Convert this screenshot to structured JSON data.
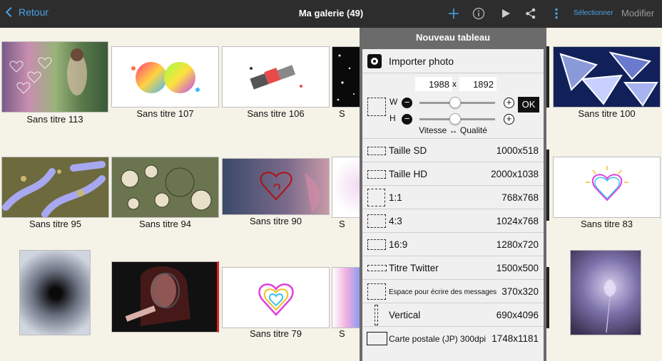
{
  "topbar": {
    "back_label": "Retour",
    "title": "Ma galerie (49)",
    "select_label": "Sélectionner",
    "modify_label": "Modifier",
    "icons": [
      "add-icon",
      "info-icon",
      "play-icon",
      "share-icon",
      "more-vert-icon"
    ]
  },
  "gallery": {
    "items": [
      {
        "caption": "Sans titre 113"
      },
      {
        "caption": "Sans titre 107"
      },
      {
        "caption": "Sans titre 106"
      },
      {
        "caption": "S"
      },
      {
        "caption": "Sans titre 100"
      },
      {
        "caption": "Sans titre 95"
      },
      {
        "caption": "Sans titre 94"
      },
      {
        "caption": "Sans titre 90"
      },
      {
        "caption": "S"
      },
      {
        "caption": "Sans titre 83"
      },
      {
        "caption": "Sans titre 79"
      },
      {
        "caption": "S"
      }
    ]
  },
  "panel": {
    "title": "Nouveau tableau",
    "import_label": "Importer photo",
    "width_value": "1988",
    "x_label": "x",
    "height_value": "1892",
    "w_label": "W",
    "h_label": "H",
    "ok_label": "OK",
    "speed_quality_label": "Vitesse ↔ Qualité",
    "presets": [
      {
        "label": "Taille SD",
        "value": "1000x518"
      },
      {
        "label": "Taille HD",
        "value": "2000x1038"
      },
      {
        "label": "1:1",
        "value": "768x768"
      },
      {
        "label": "4:3",
        "value": "1024x768"
      },
      {
        "label": "16:9",
        "value": "1280x720"
      },
      {
        "label": "Titre Twitter",
        "value": "1500x500"
      },
      {
        "label": "Espace pour écrire des messages",
        "value": "370x320"
      },
      {
        "label": "Vertical",
        "value": "690x4096"
      },
      {
        "label": "Carte postale (JP) 300dpi",
        "value": "1748x1181"
      }
    ]
  },
  "colors": {
    "topbar": "#2d2d2d",
    "accent": "#4aa3e8",
    "gallery_bg": "#f5f2e7",
    "panel_frame": "#6b6b6b",
    "panel_bg": "#f0f0f0"
  }
}
